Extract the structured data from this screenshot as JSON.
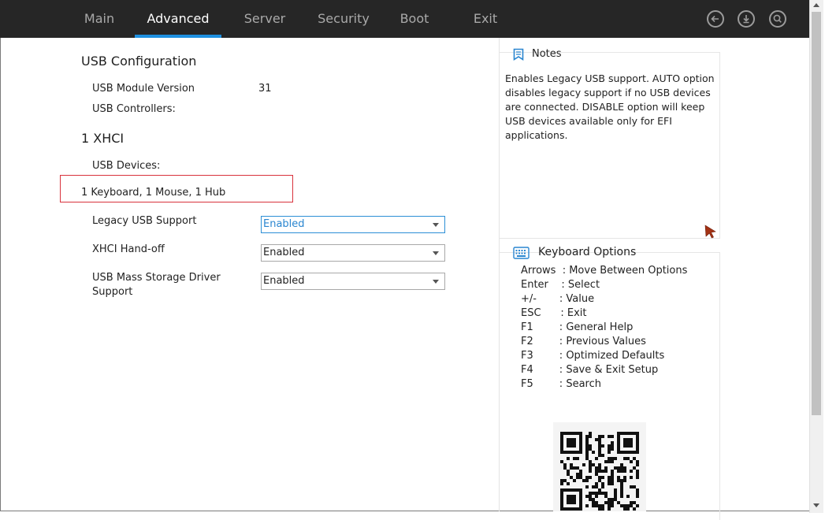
{
  "nav": {
    "tabs": [
      {
        "label": "Main",
        "active": false
      },
      {
        "label": "Advanced",
        "active": true
      },
      {
        "label": "Server",
        "active": false
      },
      {
        "label": "Security",
        "active": false
      },
      {
        "label": "Boot",
        "active": false
      },
      {
        "label": "Exit",
        "active": false
      }
    ],
    "icons": [
      "back-icon",
      "download-icon",
      "search-icon"
    ],
    "accent_color": "#1e90e0",
    "bar_color": "#262626"
  },
  "main": {
    "section_title": "USB Configuration",
    "module_version_label": "USB Module Version",
    "module_version_value": "31",
    "controllers_label": "USB Controllers:",
    "controller_title": "1 XHCI",
    "devices_label": "USB Devices:",
    "devices_value": "1 Keyboard, 1 Mouse, 1 Hub",
    "settings": [
      {
        "label": "Legacy USB Support",
        "value": "Enabled"
      },
      {
        "label": "XHCI Hand-off",
        "value": "Enabled"
      },
      {
        "label": "USB Mass Storage Driver Support",
        "value": "Enabled"
      }
    ],
    "highlight_color": "#d8323c"
  },
  "notes": {
    "title": "Notes",
    "text": "Enables Legacy USB support. AUTO option disables legacy support if no USB devices are connected. DISABLE option will keep USB devices available only for EFI applications."
  },
  "keyboard": {
    "title": "Keyboard Options",
    "rows": [
      "Arrows  : Move Between Options",
      "Enter    : Select",
      "+/-       : Value",
      "ESC      : Exit",
      "F1        : General Help",
      "F2        : Previous Values",
      "F3        : Optimized Defaults",
      "F4        : Save & Exit Setup",
      "F5        : Search"
    ]
  }
}
